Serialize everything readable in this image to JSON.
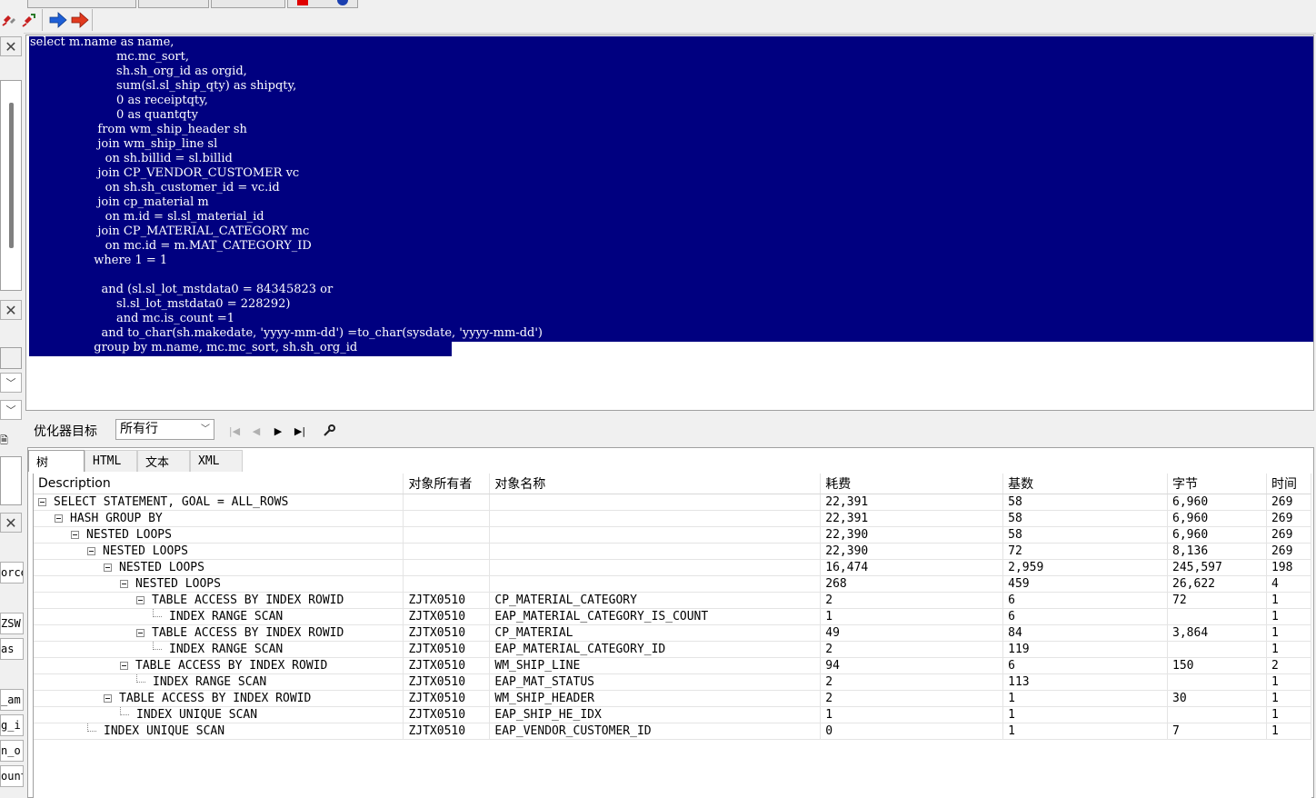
{
  "editor": {
    "sql_lines": [
      "select m.name as name,",
      "                       mc.mc_sort,",
      "                       sh.sh_org_id as orgid,",
      "                       sum(sl.sl_ship_qty) as shipqty,",
      "                       0 as receiptqty,",
      "                       0 as quantqty",
      "                  from wm_ship_header sh",
      "                  join wm_ship_line sl",
      "                    on sh.billid = sl.billid",
      "                  join CP_VENDOR_CUSTOMER vc",
      "                    on sh.sh_customer_id = vc.id",
      "                  join cp_material m",
      "                    on m.id = sl.sl_material_id",
      "                  join CP_MATERIAL_CATEGORY mc",
      "                    on mc.id = m.MAT_CATEGORY_ID",
      "                 where 1 = 1",
      "",
      "                   and (sl.sl_lot_mstdata0 = 84345823 or",
      "                       sl.sl_lot_mstdata0 = 228292)",
      "                       and mc.is_count =1",
      "                   and to_char(sh.makedate, 'yyyy-mm-dd') =to_char(sysdate, 'yyyy-mm-dd')",
      "                 group by m.name, mc.mc_sort, sh.sh_org_id"
    ]
  },
  "plan_toolbar": {
    "label": "优化器目标",
    "select_value": "所有行"
  },
  "tabs": [
    "树",
    "HTML",
    "文本",
    "XML"
  ],
  "left_strip": {
    "texts": [
      "orce",
      "ZSW",
      "as",
      "_am",
      "g_i",
      "n_o:",
      "ount"
    ]
  },
  "plan": {
    "columns": [
      "Description",
      "对象所有者",
      "对象名称",
      "耗费",
      "基数",
      "字节",
      "时间"
    ],
    "rows": [
      {
        "level": 0,
        "toggle": true,
        "desc": "SELECT STATEMENT, GOAL = ALL_ROWS",
        "owner": "",
        "name": "",
        "cost": "22,391",
        "card": "58",
        "bytes": "6,960",
        "time": "269"
      },
      {
        "level": 1,
        "toggle": true,
        "desc": "HASH GROUP BY",
        "owner": "",
        "name": "",
        "cost": "22,391",
        "card": "58",
        "bytes": "6,960",
        "time": "269"
      },
      {
        "level": 2,
        "toggle": true,
        "desc": "NESTED LOOPS",
        "owner": "",
        "name": "",
        "cost": "22,390",
        "card": "58",
        "bytes": "6,960",
        "time": "269"
      },
      {
        "level": 3,
        "toggle": true,
        "desc": "NESTED LOOPS",
        "owner": "",
        "name": "",
        "cost": "22,390",
        "card": "72",
        "bytes": "8,136",
        "time": "269"
      },
      {
        "level": 4,
        "toggle": true,
        "desc": "NESTED LOOPS",
        "owner": "",
        "name": "",
        "cost": "16,474",
        "card": "2,959",
        "bytes": "245,597",
        "time": "198"
      },
      {
        "level": 5,
        "toggle": true,
        "desc": "NESTED LOOPS",
        "owner": "",
        "name": "",
        "cost": "268",
        "card": "459",
        "bytes": "26,622",
        "time": "4"
      },
      {
        "level": 6,
        "toggle": true,
        "desc": "TABLE ACCESS BY INDEX ROWID",
        "owner": "ZJTX0510",
        "name": "CP_MATERIAL_CATEGORY",
        "cost": "2",
        "card": "6",
        "bytes": "72",
        "time": "1"
      },
      {
        "level": 7,
        "toggle": false,
        "desc": "INDEX RANGE SCAN",
        "owner": "ZJTX0510",
        "name": "EAP_MATERIAL_CATEGORY_IS_COUNT",
        "cost": "1",
        "card": "6",
        "bytes": "",
        "time": "1"
      },
      {
        "level": 6,
        "toggle": true,
        "desc": "TABLE ACCESS BY INDEX ROWID",
        "owner": "ZJTX0510",
        "name": "CP_MATERIAL",
        "cost": "49",
        "card": "84",
        "bytes": "3,864",
        "time": "1"
      },
      {
        "level": 7,
        "toggle": false,
        "desc": "INDEX RANGE SCAN",
        "owner": "ZJTX0510",
        "name": "EAP_MATERIAL_CATEGORY_ID",
        "cost": "2",
        "card": "119",
        "bytes": "",
        "time": "1"
      },
      {
        "level": 5,
        "toggle": true,
        "desc": "TABLE ACCESS BY INDEX ROWID",
        "owner": "ZJTX0510",
        "name": "WM_SHIP_LINE",
        "cost": "94",
        "card": "6",
        "bytes": "150",
        "time": "2"
      },
      {
        "level": 6,
        "toggle": false,
        "desc": "INDEX RANGE SCAN",
        "owner": "ZJTX0510",
        "name": "EAP_MAT_STATUS",
        "cost": "2",
        "card": "113",
        "bytes": "",
        "time": "1"
      },
      {
        "level": 4,
        "toggle": true,
        "desc": "TABLE ACCESS BY INDEX ROWID",
        "owner": "ZJTX0510",
        "name": "WM_SHIP_HEADER",
        "cost": "2",
        "card": "1",
        "bytes": "30",
        "time": "1"
      },
      {
        "level": 5,
        "toggle": false,
        "desc": "INDEX UNIQUE SCAN",
        "owner": "ZJTX0510",
        "name": "EAP_SHIP_HE_IDX",
        "cost": "1",
        "card": "1",
        "bytes": "",
        "time": "1"
      },
      {
        "level": 3,
        "toggle": false,
        "desc": "INDEX UNIQUE SCAN",
        "owner": "ZJTX0510",
        "name": "EAP_VENDOR_CUSTOMER_ID",
        "cost": "0",
        "card": "1",
        "bytes": "7",
        "time": "1"
      }
    ]
  },
  "icons": {
    "toolbar": [
      "disconnect-icon",
      "reconnect-icon",
      "back-arrow-icon",
      "forward-arrow-icon"
    ],
    "nav": [
      "first-icon",
      "prev-icon",
      "next-icon",
      "last-icon",
      "wrench-icon"
    ],
    "colors": {
      "selection": "#000080",
      "arrow_blue": "#1e5fd6",
      "arrow_red": "#e03a1e"
    }
  }
}
